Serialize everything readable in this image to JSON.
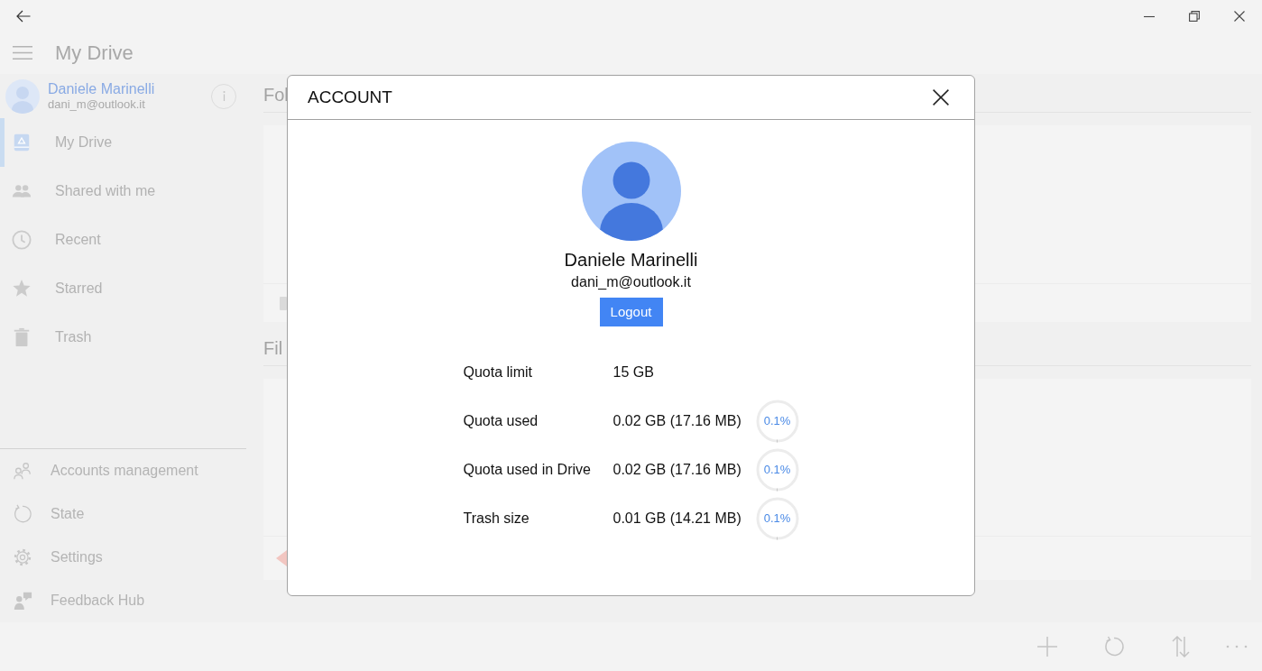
{
  "header": {
    "title": "My Drive"
  },
  "sidebar": {
    "account": {
      "name": "Daniele Marinelli",
      "email": "dani_m@outlook.it"
    },
    "items": [
      {
        "label": "My Drive",
        "selected": true
      },
      {
        "label": "Shared with me",
        "selected": false
      },
      {
        "label": "Recent",
        "selected": false
      },
      {
        "label": "Starred",
        "selected": false
      },
      {
        "label": "Trash",
        "selected": false
      }
    ],
    "footer_items": [
      {
        "label": "Accounts management"
      },
      {
        "label": "State"
      },
      {
        "label": "Settings"
      },
      {
        "label": "Feedback Hub"
      }
    ]
  },
  "content": {
    "sections": [
      {
        "heading": "Fol"
      },
      {
        "heading": "Fil"
      }
    ]
  },
  "dialog": {
    "title": "ACCOUNT",
    "name": "Daniele Marinelli",
    "email": "dani_m@outlook.it",
    "logout": "Logout",
    "rows": [
      {
        "label": "Quota limit",
        "value": "15 GB"
      },
      {
        "label": "Quota used",
        "value": "0.02 GB (17.16 MB)",
        "percent": "0.1%",
        "level": 0.001
      },
      {
        "label": "Quota used in Drive",
        "value": "0.02 GB (17.16 MB)",
        "percent": "0.1%",
        "level": 0.001
      },
      {
        "label": "Trash size",
        "value": "0.01 GB (14.21 MB)",
        "percent": "0.1%",
        "level": 0.001
      }
    ]
  }
}
